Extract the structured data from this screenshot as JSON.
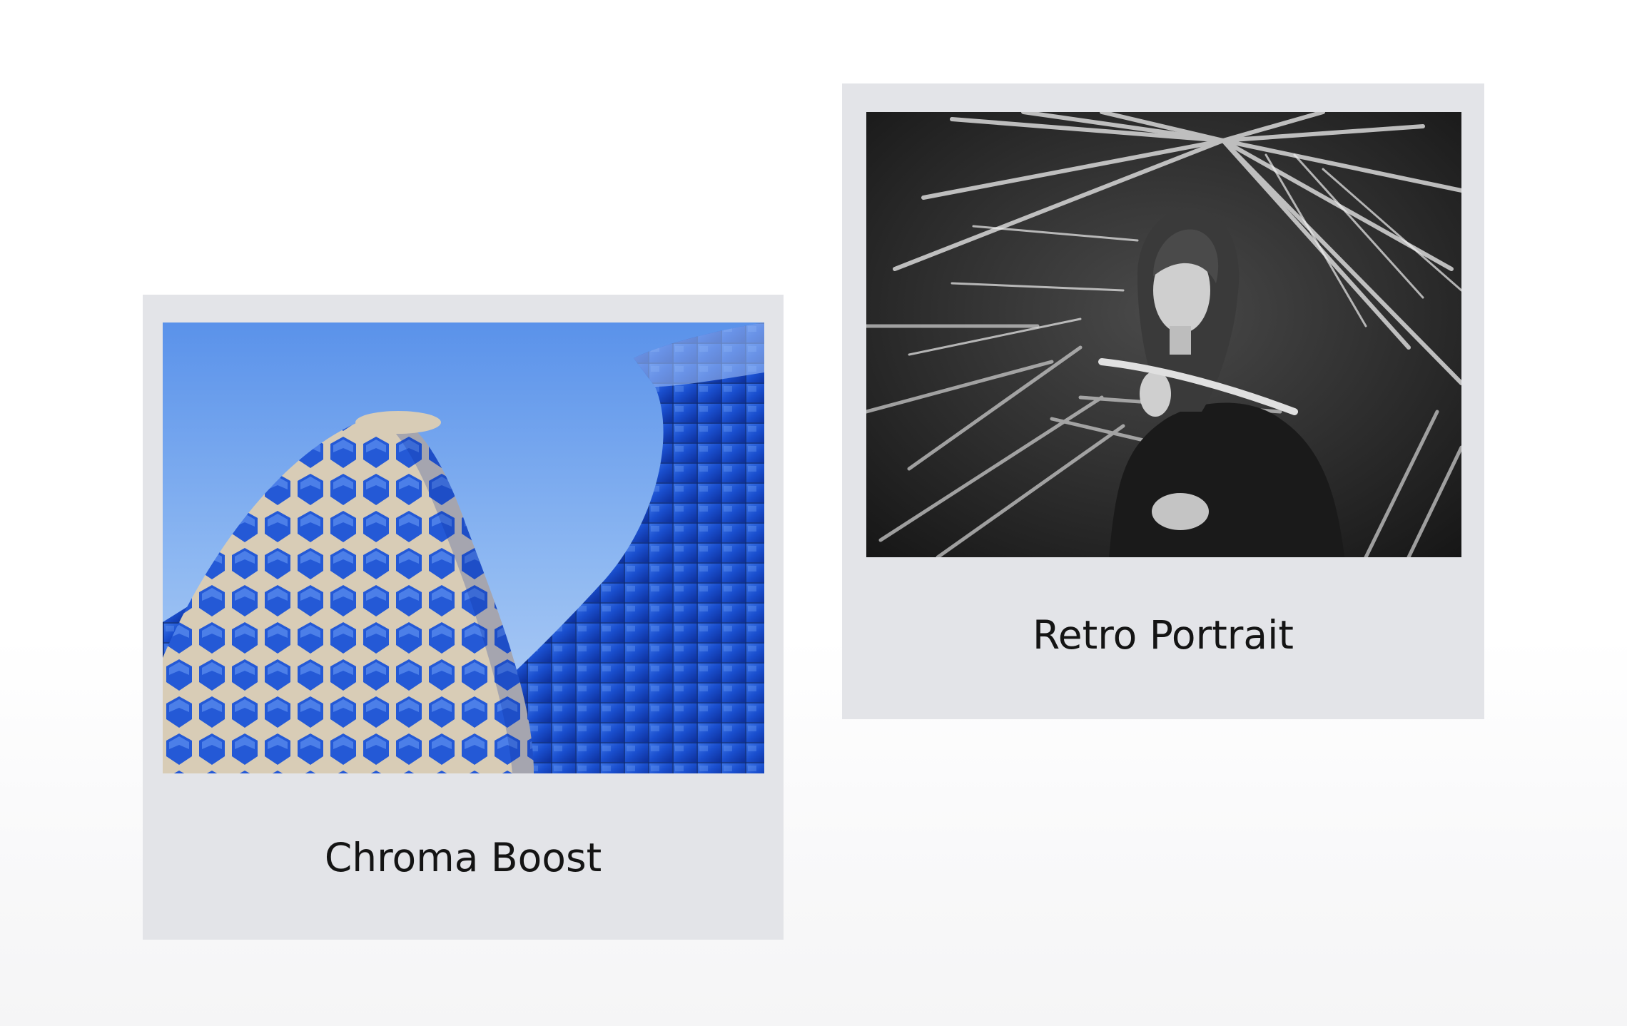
{
  "gallery": {
    "cards": [
      {
        "title": "Chroma Boost",
        "image_icon": "modern-hexagon-tower-photo",
        "accent": "#1c4fd6"
      },
      {
        "title": "Retro Portrait",
        "image_icon": "black-and-white-palm-portrait-photo",
        "accent": "#2b2b2b"
      }
    ]
  },
  "colors": {
    "card_background": "#e3e4e8",
    "page_background": "#ffffff",
    "caption_text": "#141414"
  }
}
